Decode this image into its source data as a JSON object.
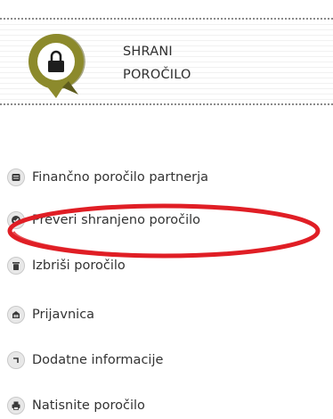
{
  "save_panel": {
    "line1": "SHRANI",
    "line2": "POROČILO",
    "icon": "lock-icon",
    "icon_color": "#8c8a2c"
  },
  "menu": {
    "items": [
      {
        "label": "Finančno poročilo partnerja",
        "icon": "report-icon"
      },
      {
        "label": "Preveri shranjeno poročilo",
        "icon": "check-icon"
      },
      {
        "label": "Izbriši poročilo",
        "icon": "trash-icon"
      },
      {
        "label": "Prijavnica",
        "icon": "form-icon"
      },
      {
        "label": "Dodatne informacije",
        "icon": "info-arrow-icon"
      },
      {
        "label": "Natisnite poročilo",
        "icon": "print-icon"
      }
    ]
  },
  "highlight_color": "#e01e25"
}
